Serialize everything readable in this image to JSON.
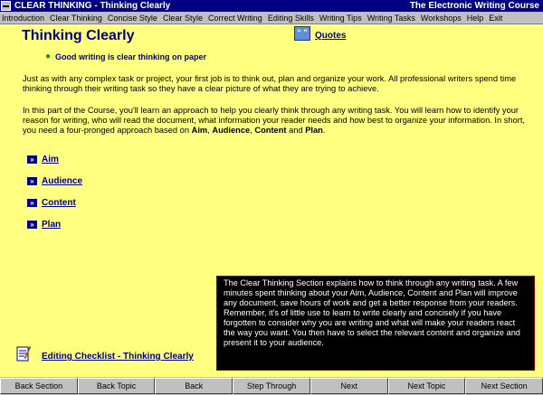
{
  "window": {
    "title": "CLEAR THINKING - Thinking Clearly",
    "app_name": "The Electronic Writing Course"
  },
  "menu": [
    "Introduction",
    "Clear Thinking",
    "Concise Style",
    "Clear Style",
    "Correct Writing",
    "Editing Skills",
    "Writing Tips",
    "Writing Tasks",
    "Workshops",
    "Help",
    "Exit"
  ],
  "page": {
    "title": "Thinking Clearly",
    "quotes_icon": "quotes-icon",
    "quotes_label": "Quotes",
    "bullet": "Good writing is clear thinking on paper",
    "para1": "Just as with any complex task or project, your first job is to think out, plan and organize your work.  All professional writers spend time thinking through their writing task so they have a clear picture of what they are trying to achieve.",
    "para2_pre": "In this part of the Course, you'll learn an approach to help you clearly think through any writing task.  You will learn how to identify your reason for writing, who will read the document, what information your reader needs and how best to organize your information.  In short, you need a four-pronged approach based on ",
    "aim": "Aim",
    "sep1": ", ",
    "audience": "Audience",
    "sep2": ", ",
    "content": "Content",
    "sep3": " and ",
    "plan": "Plan",
    "para2_end": ".",
    "nav_links": [
      "Aim",
      "Audience",
      "Content",
      "Plan"
    ],
    "nav_icon": "»",
    "info_box": "The Clear Thinking Section explains how to think through any writing task. A few minutes spent thinking about your Aim, Audience, Content and Plan will improve any document, save hours of work and get a better response from your readers.  Remember, it's of little use to learn to write clearly and concisely if you have forgotten to consider why you are writing and what will make your readers react the way you want.  You then have to select the relevant content and organize and present it to your audience.",
    "checklist_label": "Editing Checklist - Thinking Clearly"
  },
  "buttons": [
    "Back Section",
    "Back Topic",
    "Back",
    "Step Through",
    "Next",
    "Next Topic",
    "Next Section"
  ],
  "colors": {
    "title_bar": "#000080",
    "content_bg": "#ffff80",
    "link": "#000080",
    "info_bg": "#000000"
  }
}
